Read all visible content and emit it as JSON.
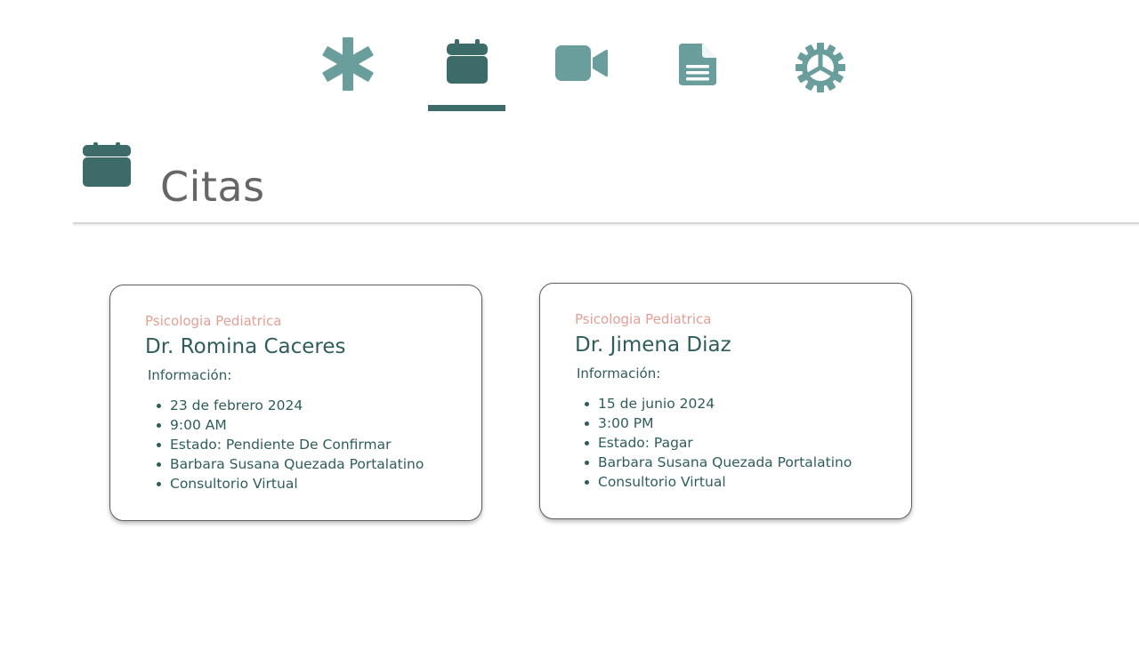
{
  "nav": {
    "items": [
      {
        "icon": "asterisk-icon",
        "active": false
      },
      {
        "icon": "calendar-icon",
        "active": true
      },
      {
        "icon": "video-camera-icon",
        "active": false
      },
      {
        "icon": "document-icon",
        "active": false
      },
      {
        "icon": "gear-icon",
        "active": false
      }
    ],
    "colors": {
      "icon": "#6a9e9c",
      "active_icon": "#3d6b6a",
      "underline": "#3d6b6a"
    }
  },
  "section": {
    "title": "Citas",
    "icon": "calendar-icon"
  },
  "appointments": [
    {
      "specialty": "Psicologia Pediatrica",
      "doctor": "Dr. Romina Caceres",
      "info_label": "Información:",
      "details": [
        "23 de febrero 2024",
        "9:00 AM",
        "Estado: Pendiente De Confirmar",
        "Barbara Susana Quezada Portalatino",
        "Consultorio Virtual"
      ]
    },
    {
      "specialty": "Psicologia Pediatrica",
      "doctor": "Dr. Jimena Diaz",
      "info_label": "Información:",
      "details": [
        "15 de junio 2024",
        "3:00 PM",
        "Estado: Pagar",
        "Barbara Susana Quezada Portalatino",
        "Consultorio Virtual"
      ]
    }
  ],
  "colors": {
    "specialty": "#e39f97",
    "text": "#2f5d5c",
    "title": "#666666"
  }
}
